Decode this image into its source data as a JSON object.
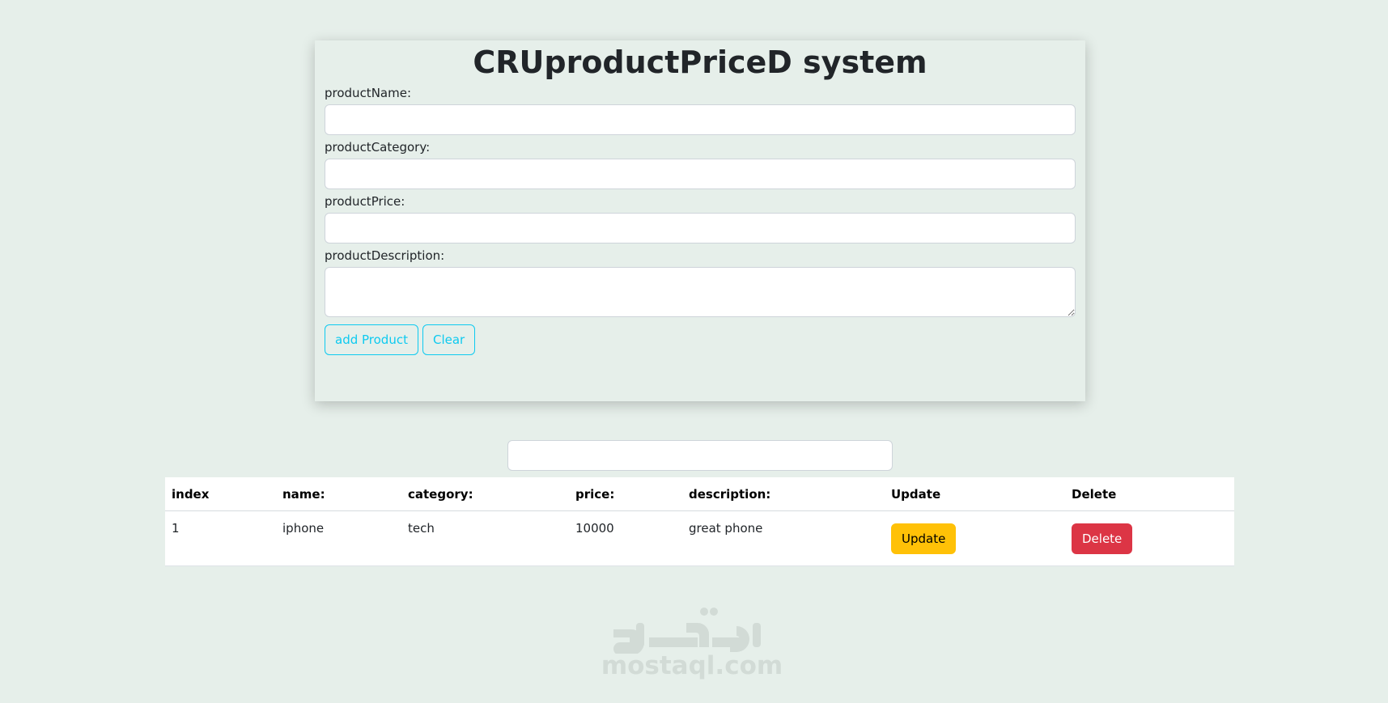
{
  "page_title": "CRUproductPriceD system",
  "form": {
    "fields": [
      {
        "label": "productName:",
        "value": ""
      },
      {
        "label": "productCategory:",
        "value": ""
      },
      {
        "label": "productPrice:",
        "value": ""
      },
      {
        "label": "productDescription:",
        "value": ""
      }
    ],
    "add_button_label": "add Product",
    "clear_button_label": "Clear"
  },
  "search": {
    "value": ""
  },
  "table": {
    "headers": [
      "index",
      "name:",
      "category:",
      "price:",
      "description:",
      "Update",
      "Delete"
    ],
    "rows": [
      {
        "index": "1",
        "name": "iphone",
        "category": "tech",
        "price": "10000",
        "description": "great phone",
        "update_label": "Update",
        "delete_label": "Delete"
      }
    ]
  },
  "watermark": {
    "text": "mostaql.com",
    "logo_text": "مستقل"
  },
  "colors": {
    "background": "#e6efea",
    "info": "#0dcaf0",
    "warning": "#ffc107",
    "danger": "#dc3545",
    "watermark": "#d2dbd6"
  }
}
